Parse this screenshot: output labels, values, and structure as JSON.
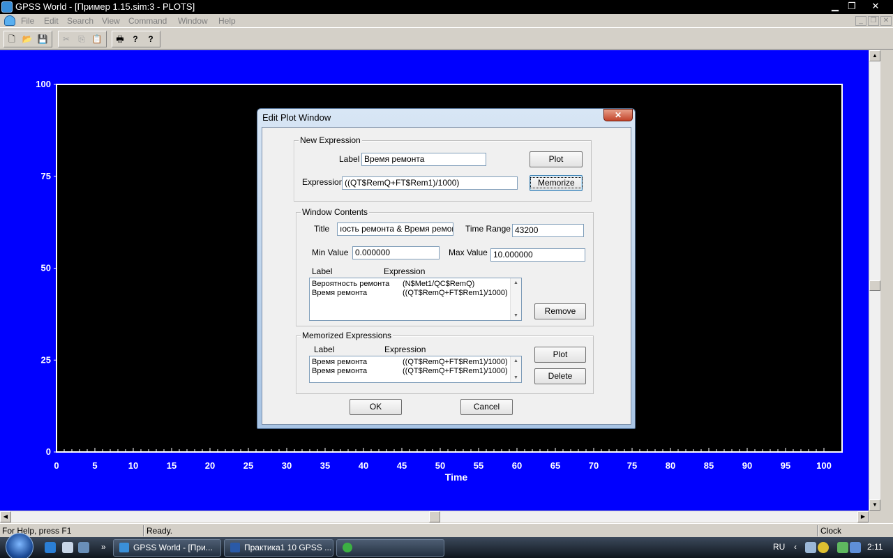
{
  "window": {
    "title": "GPSS World - [Пример 1.15.sim:3  -  PLOTS]",
    "minimize": "▁",
    "restore": "❐",
    "close": "✕"
  },
  "menu": {
    "items": [
      "File",
      "Edit",
      "Search",
      "View",
      "Command",
      "Window",
      "Help"
    ]
  },
  "toolbar": {
    "new": "🗋",
    "open": "📂",
    "save": "💾",
    "cut": "✂",
    "copy": "⎘",
    "paste": "📋",
    "print": "🖶",
    "help": "?",
    "context_help": "?"
  },
  "chart_data": {
    "type": "line",
    "x": [],
    "series": [],
    "xlabel": "Time",
    "ylabel": "",
    "xlim": [
      0,
      100
    ],
    "ylim": [
      0,
      100
    ],
    "x_ticks": [
      "0",
      "5",
      "10",
      "15",
      "20",
      "25",
      "30",
      "35",
      "40",
      "45",
      "50",
      "55",
      "60",
      "65",
      "70",
      "75",
      "80",
      "85",
      "90",
      "95",
      "100"
    ],
    "y_ticks": [
      "100",
      "75",
      "50",
      "25",
      "0"
    ],
    "background": "#0000ff",
    "plot_background": "#000000",
    "axis_color": "#ffffff"
  },
  "dialog": {
    "title": "Edit Plot Window",
    "close": "✕",
    "new_expression": {
      "title": "New Expression",
      "label_caption": "Label",
      "label_value": "Время ремонта",
      "expression_caption": "Expression",
      "expression_value": "((QT$RemQ+FT$Rem1)/1000)",
      "plot_button": "Plot",
      "memorize_button": "Memorize"
    },
    "window_contents": {
      "title": "Window Contents",
      "title_caption": "Title",
      "title_value": "ıость ремонта & Время ремонта",
      "time_range_caption": "Time Range",
      "time_range_value": "43200",
      "min_value_caption": "Min Value",
      "min_value": "0.000000",
      "max_value_caption": "Max Value",
      "max_value": "10.000000",
      "col_label": "Label",
      "col_expression": "Expression",
      "rows": [
        {
          "label": "Вероятность ремонта",
          "expression": "(N$Met1/QC$RemQ)"
        },
        {
          "label": "Время ремонта",
          "expression": "((QT$RemQ+FT$Rem1)/1000)"
        }
      ],
      "remove_button": "Remove"
    },
    "memorized": {
      "title": "Memorized Expressions",
      "col_label": "Label",
      "col_expression": "Expression",
      "rows": [
        {
          "label": "Время ремонта",
          "expression": "((QT$RemQ+FT$Rem1)/1000)"
        },
        {
          "label": "Время ремонта",
          "expression": "((QT$RemQ+FT$Rem1)/1000)"
        }
      ],
      "plot_button": "Plot",
      "delete_button": "Delete"
    },
    "ok_button": "OK",
    "cancel_button": "Cancel"
  },
  "status": {
    "help": "For Help, press F1",
    "state": "Ready.",
    "clock": "Clock"
  },
  "taskbar": {
    "tasks": [
      "GPSS World - [При...",
      "Практика1 10 GPSS ...",
      ""
    ],
    "lang": "RU",
    "time": "2:11",
    "tray_arrow": "‹"
  }
}
